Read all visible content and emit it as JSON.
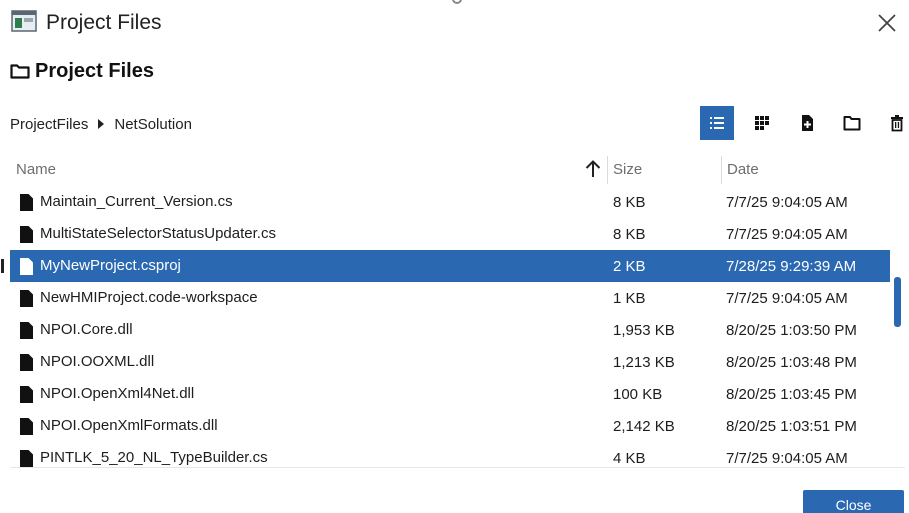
{
  "window": {
    "title": "Project Files",
    "close_icon": "close-icon"
  },
  "heading": {
    "icon": "folder-icon",
    "title": "Project Files"
  },
  "breadcrumb": {
    "items": [
      "ProjectFiles",
      "NetSolution"
    ],
    "separator_icon": "caret-right-icon"
  },
  "toolbar": {
    "buttons": [
      {
        "icon": "list-view-icon",
        "active": true
      },
      {
        "icon": "grid-view-icon",
        "active": false
      },
      {
        "icon": "new-file-icon",
        "active": false
      },
      {
        "icon": "folder-icon",
        "active": false
      },
      {
        "icon": "trash-icon",
        "active": false
      }
    ]
  },
  "table": {
    "columns": {
      "name": "Name",
      "size": "Size",
      "date": "Date"
    },
    "sort": {
      "column": "name",
      "direction": "ascending",
      "icon": "arrow-up-icon"
    },
    "rows": [
      {
        "name": "Maintain_Current_Version.cs",
        "size": "8 KB",
        "date": "7/7/25 9:04:05 AM",
        "selected": false
      },
      {
        "name": "MultiStateSelectorStatusUpdater.cs",
        "size": "8 KB",
        "date": "7/7/25 9:04:05 AM",
        "selected": false
      },
      {
        "name": "MyNewProject.csproj",
        "size": "2 KB",
        "date": "7/28/25 9:29:39 AM",
        "selected": true
      },
      {
        "name": "NewHMIProject.code-workspace",
        "size": "1 KB",
        "date": "7/7/25 9:04:05 AM",
        "selected": false
      },
      {
        "name": "NPOI.Core.dll",
        "size": "1,953 KB",
        "date": "8/20/25 1:03:50 PM",
        "selected": false
      },
      {
        "name": "NPOI.OOXML.dll",
        "size": "1,213 KB",
        "date": "8/20/25 1:03:48 PM",
        "selected": false
      },
      {
        "name": "NPOI.OpenXml4Net.dll",
        "size": "100 KB",
        "date": "8/20/25 1:03:45 PM",
        "selected": false
      },
      {
        "name": "NPOI.OpenXmlFormats.dll",
        "size": "2,142 KB",
        "date": "8/20/25 1:03:51 PM",
        "selected": false
      },
      {
        "name": "PINTLK_5_20_NL_TypeBuilder.cs",
        "size": "4 KB",
        "date": "7/7/25 9:04:05 AM",
        "selected": false
      }
    ]
  },
  "footer": {
    "close_label": "Close"
  },
  "colors": {
    "accent": "#2a68b2",
    "header_text": "#6e6e6e",
    "text": "#1d1d1d"
  }
}
